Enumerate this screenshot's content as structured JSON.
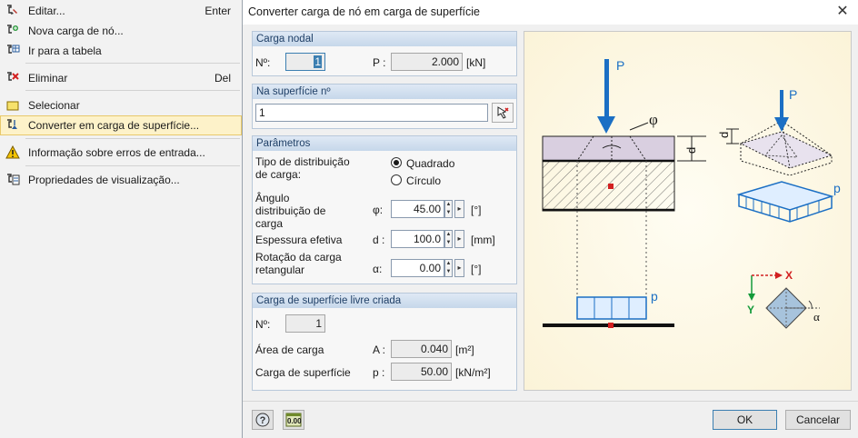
{
  "menu": {
    "items": [
      {
        "label": "Editar...",
        "shortcut": "Enter",
        "icon": "edit-load-icon"
      },
      {
        "label": "Nova carga de nó...",
        "shortcut": "",
        "icon": "new-load-icon"
      },
      {
        "label": "Ir para a tabela",
        "shortcut": "",
        "icon": "table-icon"
      },
      {
        "label": "Eliminar",
        "shortcut": "Del",
        "icon": "delete-icon"
      },
      {
        "label": "Selecionar",
        "shortcut": "",
        "icon": "select-icon"
      },
      {
        "label": "Converter em carga de superfície...",
        "shortcut": "",
        "icon": "convert-icon"
      },
      {
        "label": "Informação sobre erros de entrada...",
        "shortcut": "",
        "icon": "warning-icon"
      },
      {
        "label": "Propriedades de visualização...",
        "shortcut": "",
        "icon": "properties-icon"
      }
    ]
  },
  "dialog": {
    "title": "Converter carga de nó em carga de superfície",
    "close": "✕",
    "nodal": {
      "header": "Carga nodal",
      "no_label": "Nº:",
      "no_value": "1",
      "p_label": "P :",
      "p_value": "2.000",
      "p_unit": "[kN]"
    },
    "surface": {
      "header": "Na superfície nº",
      "value": "1"
    },
    "params": {
      "header": "Parâmetros",
      "dist_type_label": "Tipo de distribuição de carga:",
      "opt_square": "Quadrado",
      "opt_circle": "Círculo",
      "angle_label": "Ângulo distribuição de carga",
      "angle_sym": "φ:",
      "angle_value": "45.00",
      "angle_unit": "[°]",
      "thick_label": "Espessura efetiva",
      "thick_sym": "d :",
      "thick_value": "100.0",
      "thick_unit": "[mm]",
      "rot_label": "Rotação da carga retangular",
      "rot_sym": "α:",
      "rot_value": "0.00",
      "rot_unit": "[°]"
    },
    "created": {
      "header": "Carga de superfície livre criada",
      "no_label": "Nº:",
      "no_value": "1",
      "area_label": "Área de carga",
      "area_sym": "A :",
      "area_value": "0.040",
      "area_unit": "[m²]",
      "load_label": "Carga de superfície",
      "load_sym": "p :",
      "load_value": "50.00",
      "load_unit": "[kN/m²]"
    },
    "illustration": {
      "P_left": "P",
      "phi": "φ",
      "d_left": "d",
      "p_bottom": "p",
      "P_right": "P",
      "d_right": "d",
      "p_right": "p",
      "axis_x": "X",
      "axis_y": "Y",
      "alpha": "α",
      "load_color": "#1b6fc4",
      "axis_red": "#d22020",
      "axis_green": "#139a3a"
    },
    "footer": {
      "help_icon": "help-icon",
      "units_icon": "units-icon",
      "units_text": "0.00",
      "ok": "OK",
      "cancel": "Cancelar"
    }
  }
}
